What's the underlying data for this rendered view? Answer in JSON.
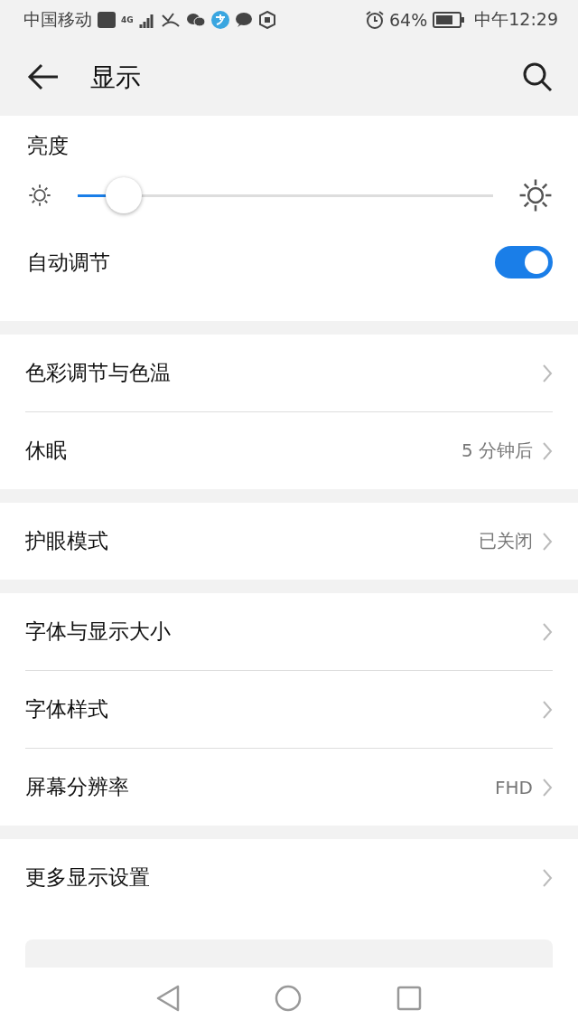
{
  "status_bar": {
    "carrier": "中国移动",
    "network": "4G",
    "battery": "64%",
    "time": "中午12:29"
  },
  "header": {
    "title": "显示"
  },
  "brightness": {
    "label": "亮度",
    "level": 0.11
  },
  "auto_adjust": {
    "label": "自动调节",
    "on": true
  },
  "groups": [
    [
      {
        "label": "色彩调节与色温"
      },
      {
        "label": "休眠",
        "value": "5 分钟后"
      }
    ],
    [
      {
        "label": "护眼模式",
        "value": "已关闭"
      }
    ],
    [
      {
        "label": "字体与显示大小"
      },
      {
        "label": "字体样式"
      },
      {
        "label": "屏幕分辨率",
        "value": "FHD"
      }
    ],
    [
      {
        "label": "更多显示设置"
      }
    ]
  ]
}
